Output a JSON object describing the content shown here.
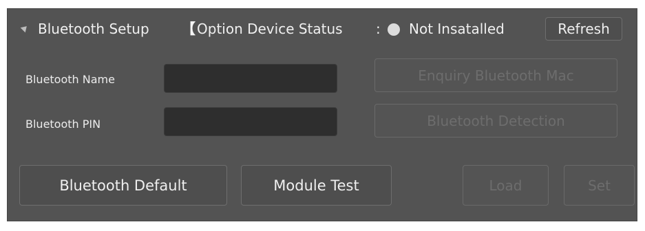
{
  "header": {
    "title": "Bluetooth Setup",
    "bracket": "【",
    "status_label": "Option Device Status",
    "colon": ":",
    "status_value": "Not Insatalled",
    "refresh_label": "Refresh"
  },
  "fields": {
    "name_label": "Bluetooth Name",
    "name_value": "",
    "pin_label": "Bluetooth PIN",
    "pin_value": ""
  },
  "buttons": {
    "enquiry_mac": "Enquiry Bluetooth Mac",
    "detection": "Bluetooth Detection",
    "default": "Bluetooth Default",
    "module_test": "Module Test",
    "load": "Load",
    "set": "Set"
  },
  "icons": {
    "collapse": "collapse-triangle-icon",
    "status": "status-dot-icon"
  },
  "colors": {
    "panel_bg": "#535353",
    "status_dot": "#dcdcdc",
    "disabled_text": "#6d6d6d"
  }
}
